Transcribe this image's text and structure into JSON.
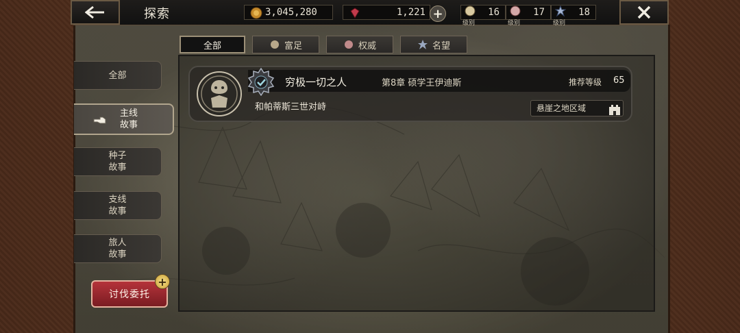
{
  "header": {
    "title": "探索",
    "coins": "3,045,280",
    "gems": "1,221",
    "stats": [
      {
        "icon": "wealth-level-icon",
        "label": "级别",
        "value": "16"
      },
      {
        "icon": "authority-level-icon",
        "label": "级别",
        "value": "17"
      },
      {
        "icon": "fame-level-icon",
        "label": "级别",
        "value": "18"
      }
    ]
  },
  "category_tabs": [
    {
      "label": "全部",
      "icon": "",
      "active": true
    },
    {
      "label": "富足",
      "icon": "wealth-icon",
      "active": false
    },
    {
      "label": "权威",
      "icon": "authority-icon",
      "active": false
    },
    {
      "label": "名望",
      "icon": "fame-icon",
      "active": false
    }
  ],
  "side_nav": [
    {
      "label": "全部",
      "active": false
    },
    {
      "label": "主线\n故事",
      "line1": "主线",
      "line2": "故事",
      "active": true
    },
    {
      "line1": "种子",
      "line2": "故事",
      "active": false
    },
    {
      "line1": "支线",
      "line2": "故事",
      "active": false
    },
    {
      "line1": "旅人",
      "line2": "故事",
      "active": false
    }
  ],
  "hunt_button": {
    "label": "讨伐委托",
    "badge": "+"
  },
  "quest": {
    "title": "穷极一切之人",
    "chapter": "第8章  硕学王伊迪斯",
    "recommended_label": "推荐等级",
    "recommended_level": "65",
    "subtitle": "和帕蒂斯三世对峙",
    "region": "悬崖之地区域"
  },
  "colors": {
    "accent_red": "#b5333a",
    "frame_brown": "#4a2a1a",
    "panel_dark": "#121212"
  }
}
